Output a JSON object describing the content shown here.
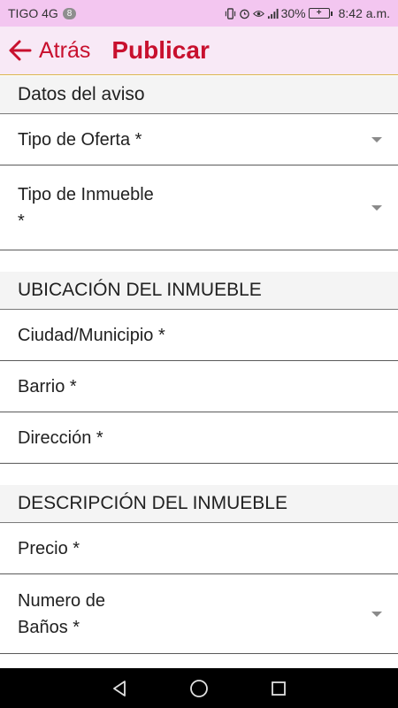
{
  "status_bar": {
    "carrier": "TIGO 4G",
    "notification_count": "8",
    "battery_percent": "30%",
    "time": "8:42 a.m."
  },
  "app_bar": {
    "back_label": "Atrás",
    "title": "Publicar",
    "accent_color": "#c8102e"
  },
  "sections": {
    "datos": {
      "header": "Datos del aviso",
      "tipo_oferta": "Tipo de Oferta *",
      "tipo_inmueble_line1": "Tipo de Inmueble",
      "tipo_inmueble_line2": "*"
    },
    "ubicacion": {
      "header": "UBICACIÓN DEL INMUEBLE",
      "ciudad": "Ciudad/Municipio *",
      "barrio": "Barrio *",
      "direccion": "Dirección *"
    },
    "descripcion": {
      "header": "DESCRIPCIÓN DEL INMUEBLE",
      "precio": "Precio *",
      "banos_line1": "Numero de",
      "banos_line2": "Baños *"
    }
  },
  "icons": {
    "back": "arrow-left-icon",
    "dropdown": "caret-down-icon",
    "nav_back": "triangle-back-icon",
    "nav_home": "circle-home-icon",
    "nav_recents": "square-recents-icon"
  }
}
